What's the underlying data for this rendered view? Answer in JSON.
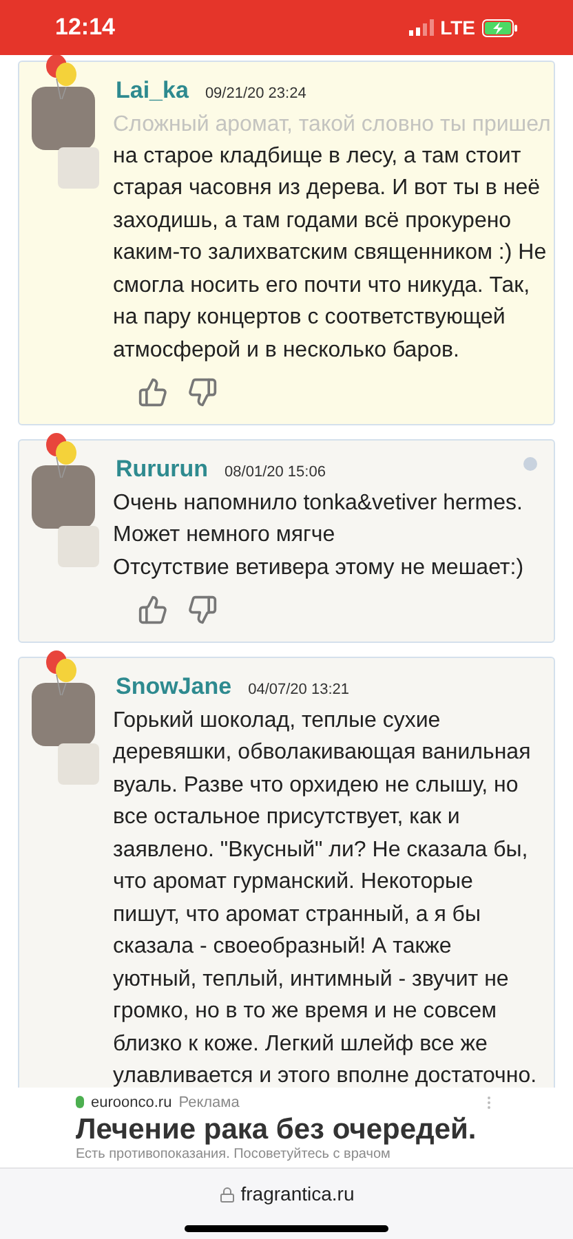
{
  "status_bar": {
    "time": "12:14",
    "network": "LTE",
    "charging": true
  },
  "comments": [
    {
      "user": "Lai_ka",
      "date": "09/21/20 23:24",
      "highlight": true,
      "faded_text": "Сложный аромат, такой словно ты пришел",
      "paragraphs": [
        "на старое кладбище в лесу, а там стоит старая часовня из дерева. И вот ты в неё заходишь, а там годами всё прокурено каким-то залихватским священником :) Не смогла носить его почти что никуда. Так, на пару концертов с соответствующей атмосферой и в несколько баров."
      ]
    },
    {
      "user": "Rururun",
      "date": "08/01/20 15:06",
      "highlight": false,
      "paragraphs": [
        "Очень напомнило tonka&vetiver hermes.",
        "Может немного мягче",
        "Отсутствие ветивера этому не мешает:)"
      ]
    },
    {
      "user": "SnowJane",
      "date": "04/07/20 13:21",
      "highlight": false,
      "paragraphs": [
        "Горький шоколад, теплые сухие деревяшки, обволакивающая ванильная вуаль. Разве что орхидею не слышу, но все остальное присутствует, как и заявлено. \"Вкусный\" ли? Не сказала бы, что аромат гурманский. Некоторые пишут, что аромат странный, а я бы сказала - своеобразный! А также уютный, теплый, интимный - звучит не громко, но в то же время и не совсем близко к коже. Легкий шлейф все же улавливается и этого вполне достаточно."
      ]
    }
  ],
  "ad": {
    "domain": "euroonco.ru",
    "label": "Реклама",
    "headline": "Лечение рака без очередей.",
    "disclaimer": "Есть противопоказания. Посоветуйтесь с врачом"
  },
  "address_bar": {
    "url": "fragrantica.ru"
  }
}
